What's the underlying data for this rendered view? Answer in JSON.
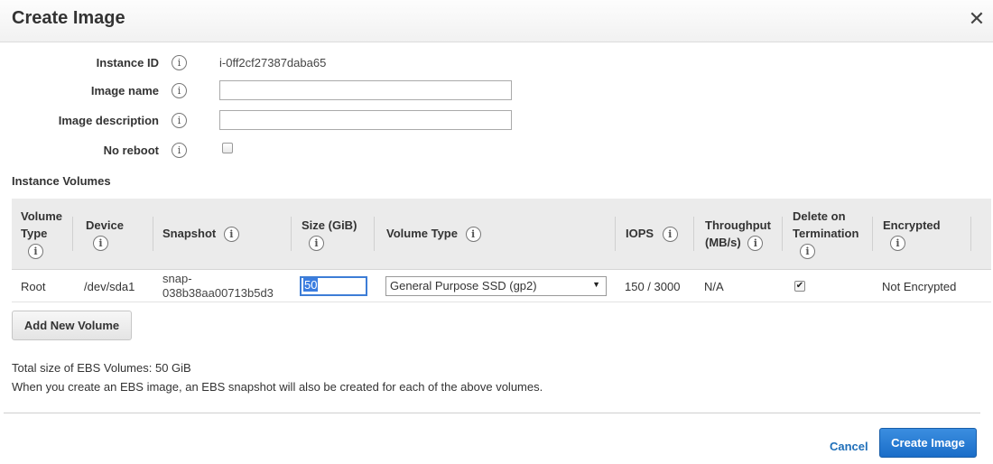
{
  "dialog": {
    "title": "Create Image",
    "close_label": "✕"
  },
  "form": {
    "instance_id_label": "Instance ID",
    "instance_id_value": "i-0ff2cf27387daba65",
    "image_name_label": "Image name",
    "image_name_value": "",
    "image_description_label": "Image description",
    "image_description_value": "",
    "no_reboot_label": "No reboot",
    "no_reboot_checked": false
  },
  "volumes": {
    "section_title": "Instance Volumes",
    "headers": {
      "volume_type_1": "Volume",
      "volume_type_2": "Type",
      "device": "Device",
      "snapshot": "Snapshot",
      "size": "Size (GiB)",
      "volume_type_col": "Volume Type",
      "iops": "IOPS",
      "throughput_1": "Throughput",
      "throughput_2": "(MB/s)",
      "delete_1": "Delete on",
      "delete_2": "Termination",
      "encrypted": "Encrypted"
    },
    "rows": [
      {
        "volume_type": "Root",
        "device": "/dev/sda1",
        "snapshot_1": "snap-",
        "snapshot_2": "038b38aa00713b5d3",
        "size": "50",
        "volume_type_value": "General Purpose SSD (gp2)",
        "iops": "150 / 3000",
        "throughput": "N/A",
        "delete_on_termination": true,
        "encrypted": "Not Encrypted"
      }
    ],
    "add_button": "Add New Volume"
  },
  "summary": {
    "total": "Total size of EBS Volumes: 50 GiB",
    "note": "When you create an EBS image, an EBS snapshot will also be created for each of the above volumes."
  },
  "footer": {
    "cancel": "Cancel",
    "create": "Create Image"
  },
  "icons": {
    "info": "info-icon",
    "close": "close-icon",
    "checkbox": "checkbox-icon",
    "dropdown": "chevron-down-icon"
  },
  "colors": {
    "primary_button": "#1a6dc8",
    "link": "#1f6fb9",
    "header_bg": "#f1f1f1",
    "table_header_bg": "#ebebeb"
  }
}
